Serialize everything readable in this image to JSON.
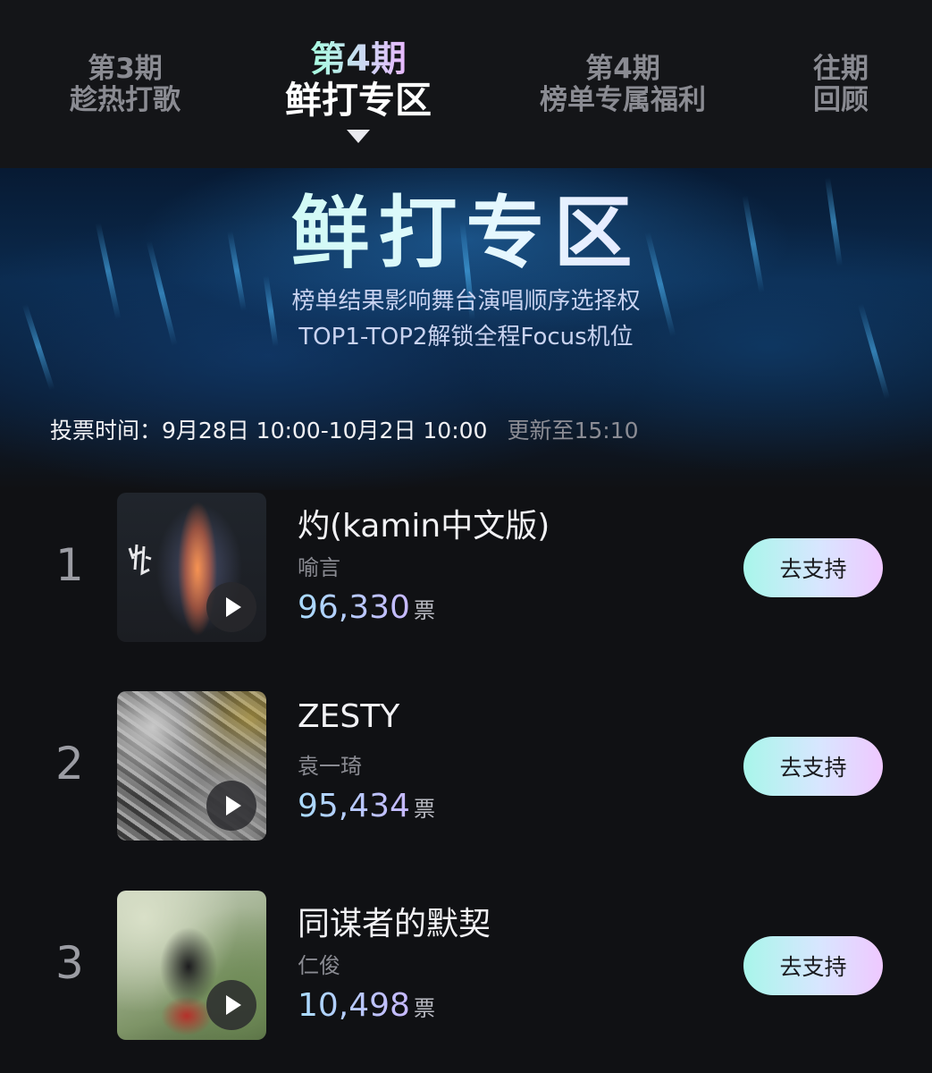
{
  "tabs": [
    {
      "line1": "第3期",
      "line2": "趁热打歌",
      "active": false
    },
    {
      "line1": "第4期",
      "line2": "鲜打专区",
      "active": true
    },
    {
      "line1": "第4期",
      "line2": "榜单专属福利",
      "active": false
    },
    {
      "line1": "往期",
      "line2": "回顾",
      "active": false
    }
  ],
  "hero": {
    "title": "鲜打专区",
    "subtitle1": "榜单结果影响舞台演唱顺序选择权",
    "subtitle2": "TOP1-TOP2解锁全程Focus机位"
  },
  "vote": {
    "time": "投票时间：9月28日 10:00-10月2日 10:00",
    "updated": "更新至15:10"
  },
  "songs": [
    {
      "rank": "1",
      "title": "灼(kamin中文版)",
      "artist": "喻言",
      "votes": "96,330",
      "unit": "票",
      "button": "去支持"
    },
    {
      "rank": "2",
      "title": "ZESTY",
      "artist": "袁一琦",
      "votes": "95,434",
      "unit": "票",
      "button": "去支持"
    },
    {
      "rank": "3",
      "title": "同谋者的默契",
      "artist": "仁俊",
      "votes": "10,498",
      "unit": "票",
      "button": "去支持"
    }
  ],
  "colors": {
    "background": "#101114",
    "accent_gradient_start": "#a8f6ea",
    "accent_gradient_end": "#efc8ff"
  }
}
